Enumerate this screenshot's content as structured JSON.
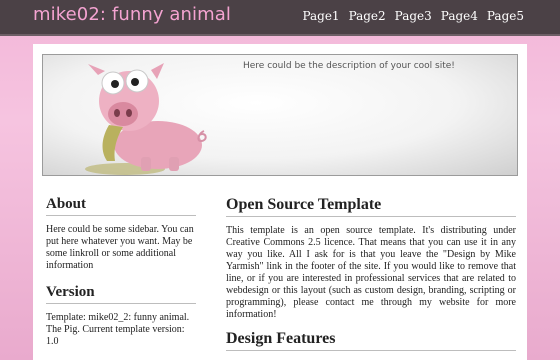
{
  "header": {
    "site_title": "mike02: funny animal",
    "nav": [
      "Page1",
      "Page2",
      "Page3",
      "Page4",
      "Page5"
    ]
  },
  "banner": {
    "description": "Here could be the description of your cool site!"
  },
  "sidebar": {
    "about_title": "About",
    "about_text": "Here could be some sidebar. You can put here whatever you want. May be some linkroll or some additional information",
    "version_title": "Version",
    "version_text": "Template: mike02_2: funny animal. The Pig. Current template version: 1.0"
  },
  "main": {
    "title": "Open Source Template",
    "text": "This template is an open source template. It's distributing under Creative Commons 2.5 licence. That means that you can use it in any way you like. All I ask for is that you leave the \"Design by Mike Yarmish\" link in the footer of the site. If you would like to remove that line, or if you are interested in professional services that are related to webdesign or this layout (such as custom design, branding, scripting or programming), please contact me through my website for more information!",
    "features_title": "Design Features"
  },
  "colors": {
    "header_bg": "#4b4146",
    "site_title": "#f4a3d1",
    "page_bg_pink": "#f2b6d8"
  }
}
